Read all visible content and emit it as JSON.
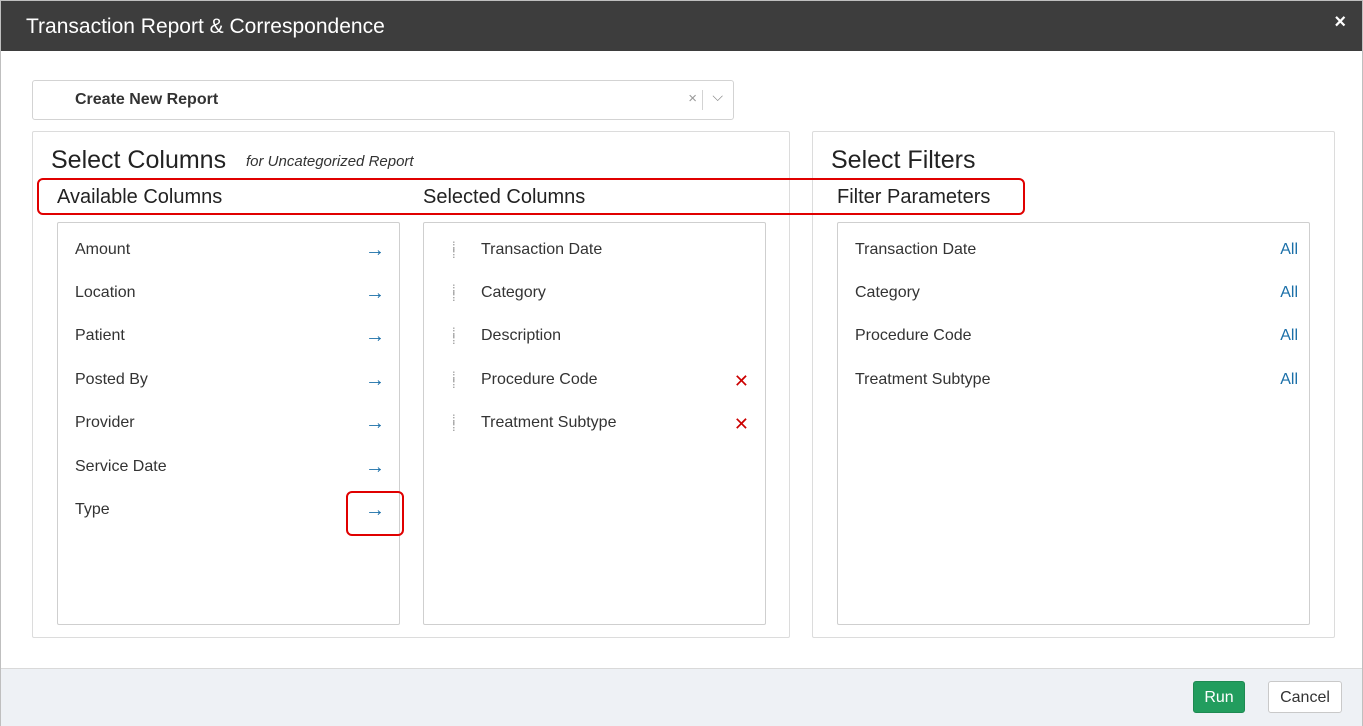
{
  "dialog": {
    "title": "Transaction Report & Correspondence",
    "close_label": "×"
  },
  "report_select": {
    "value": "Create New Report",
    "clear_label": "×",
    "chevron": "⌵"
  },
  "columns_panel": {
    "title": "Select Columns",
    "subtitle": "for Uncategorized Report",
    "available_header": "Available Columns",
    "selected_header": "Selected Columns",
    "available": [
      {
        "label": "Amount",
        "action_icon": "arrow-right-icon"
      },
      {
        "label": "Location",
        "action_icon": "arrow-right-icon"
      },
      {
        "label": "Patient",
        "action_icon": "arrow-right-icon"
      },
      {
        "label": "Posted By",
        "action_icon": "arrow-right-icon"
      },
      {
        "label": "Provider",
        "action_icon": "arrow-right-icon"
      },
      {
        "label": "Service Date",
        "action_icon": "arrow-right-icon"
      },
      {
        "label": "Type",
        "action_icon": "arrow-right-icon"
      }
    ],
    "selected": [
      {
        "label": "Transaction Date",
        "removable": false
      },
      {
        "label": "Category",
        "removable": false
      },
      {
        "label": "Description",
        "removable": false
      },
      {
        "label": "Procedure Code",
        "removable": true
      },
      {
        "label": "Treatment Subtype",
        "removable": true
      }
    ]
  },
  "filters_panel": {
    "title": "Select Filters",
    "parameters_header": "Filter Parameters",
    "filters": [
      {
        "label": "Transaction Date",
        "value": "All"
      },
      {
        "label": "Category",
        "value": "All"
      },
      {
        "label": "Procedure Code",
        "value": "All"
      },
      {
        "label": "Treatment Subtype",
        "value": "All"
      }
    ]
  },
  "footer": {
    "run_label": "Run",
    "cancel_label": "Cancel"
  },
  "colors": {
    "titlebar": "#3d3d3d",
    "link": "#1a6fa8",
    "remove": "#cc0000",
    "run": "#229d5e",
    "highlight": "#e00000"
  }
}
